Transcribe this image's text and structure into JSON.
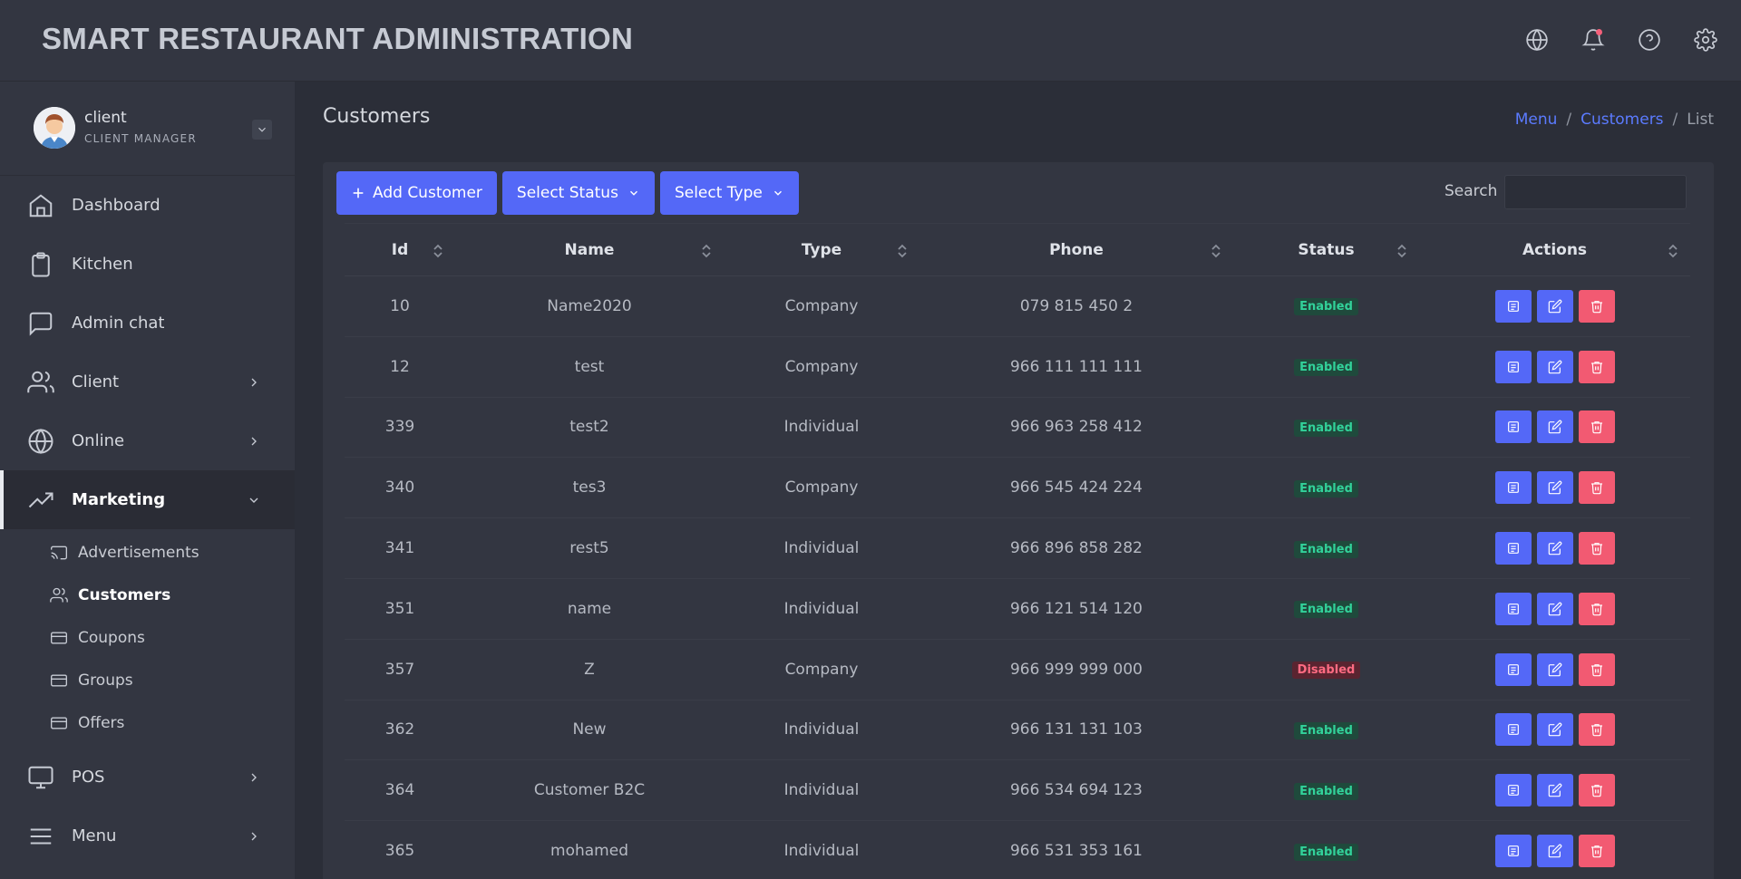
{
  "app": {
    "title": "SMART RESTAURANT ADMINISTRATION"
  },
  "header_icons": [
    "globe-icon",
    "bell-icon",
    "help-icon",
    "gear-icon"
  ],
  "user": {
    "name": "client",
    "role": "CLIENT MANAGER"
  },
  "sidebar": {
    "items": [
      {
        "label": "Dashboard",
        "icon": "home-icon"
      },
      {
        "label": "Kitchen",
        "icon": "clipboard-icon"
      },
      {
        "label": "Admin chat",
        "icon": "chat-icon"
      },
      {
        "label": "Client",
        "icon": "users-icon"
      },
      {
        "label": "Online",
        "icon": "globe-icon"
      },
      {
        "label": "Marketing",
        "icon": "trending-up-icon"
      },
      {
        "label": "POS",
        "icon": "monitor-icon"
      },
      {
        "label": "Menu",
        "icon": "menu-icon"
      }
    ],
    "marketing_sub": [
      {
        "label": "Advertisements",
        "icon": "cast-icon"
      },
      {
        "label": "Customers",
        "icon": "users-icon"
      },
      {
        "label": "Coupons",
        "icon": "card-icon"
      },
      {
        "label": "Groups",
        "icon": "card-icon"
      },
      {
        "label": "Offers",
        "icon": "card-icon"
      }
    ]
  },
  "page": {
    "title": "Customers",
    "breadcrumb": [
      "Menu",
      "Customers",
      "List"
    ]
  },
  "toolbar": {
    "add_label": "Add Customer",
    "status_label": "Select Status",
    "type_label": "Select Type",
    "search_label": "Search",
    "search_value": ""
  },
  "table": {
    "columns": [
      "Id",
      "Name",
      "Type",
      "Phone",
      "Status",
      "Actions"
    ],
    "rows": [
      {
        "id": "10",
        "name": "Name2020",
        "type": "Company",
        "phone": "079 815 450 2",
        "status": "Enabled"
      },
      {
        "id": "12",
        "name": "test",
        "type": "Company",
        "phone": "966 111 111 111",
        "status": "Enabled"
      },
      {
        "id": "339",
        "name": "test2",
        "type": "Individual",
        "phone": "966 963 258 412",
        "status": "Enabled"
      },
      {
        "id": "340",
        "name": "tes3",
        "type": "Company",
        "phone": "966 545 424 224",
        "status": "Enabled"
      },
      {
        "id": "341",
        "name": "rest5",
        "type": "Individual",
        "phone": "966 896 858 282",
        "status": "Enabled"
      },
      {
        "id": "351",
        "name": "name",
        "type": "Individual",
        "phone": "966 121 514 120",
        "status": "Enabled"
      },
      {
        "id": "357",
        "name": "Z",
        "type": "Company",
        "phone": "966 999 999 000",
        "status": "Disabled"
      },
      {
        "id": "362",
        "name": "New",
        "type": "Individual",
        "phone": "966 131 131 103",
        "status": "Enabled"
      },
      {
        "id": "364",
        "name": "Customer B2C",
        "type": "Individual",
        "phone": "966 534 694 123",
        "status": "Enabled"
      },
      {
        "id": "365",
        "name": "mohamed",
        "type": "Individual",
        "phone": "966 531 353 161",
        "status": "Enabled"
      }
    ]
  },
  "colors": {
    "accent": "#5468f7",
    "danger": "#f25a72",
    "enabled": "#32d29a",
    "disabled": "#ff6b82",
    "background": "#2b2e38",
    "panel": "#333641"
  }
}
